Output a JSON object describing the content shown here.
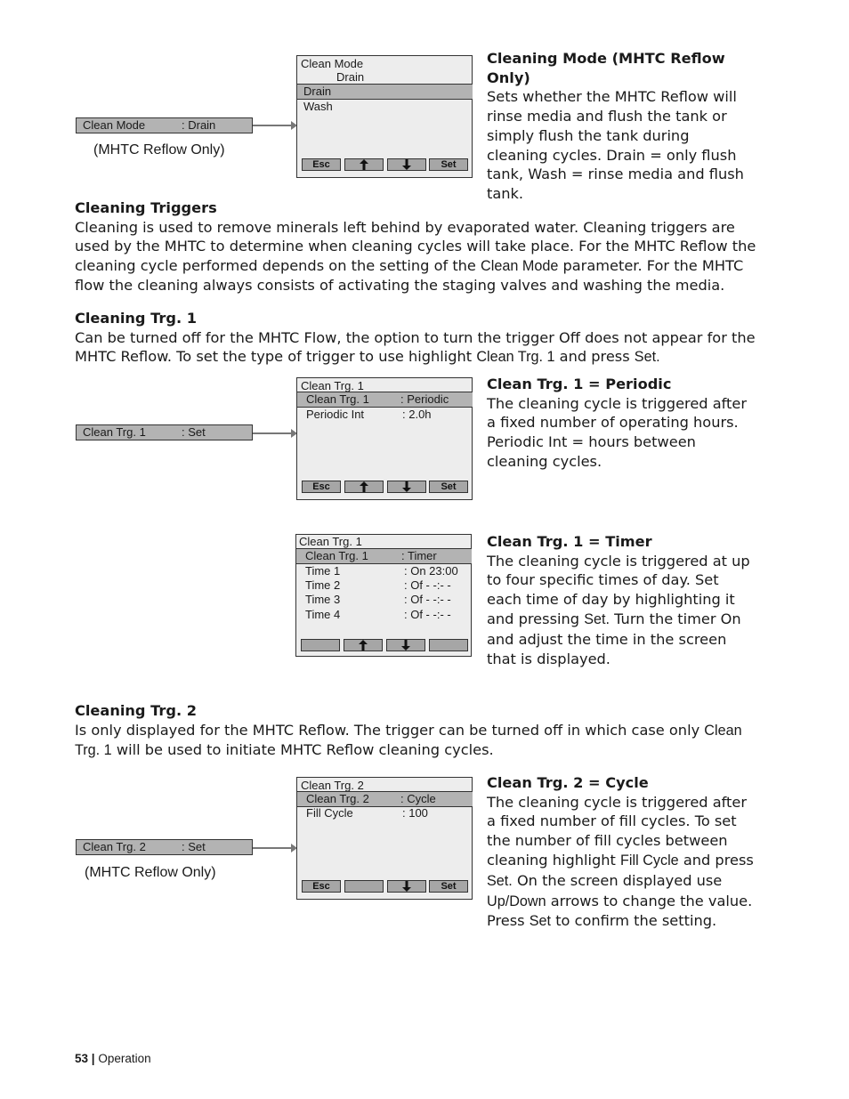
{
  "section1": {
    "param_bar": {
      "name": "Clean Mode",
      "value": ": Drain"
    },
    "note": "(MHTC Reflow Only)",
    "screen": {
      "title": "Clean Mode",
      "subtitle": "Drain",
      "options": [
        "Drain",
        "Wash"
      ],
      "buttons": {
        "left": "Esc",
        "up": "up-arrow",
        "down": "down-arrow",
        "right": "Set"
      }
    },
    "desc_title": "Cleaning Mode (MHTC Reflow Only)",
    "desc_text": "Sets whether the MHTC Reflow will rinse media and flush the tank or simply flush the tank during cleaning cycles.  Drain = only flush tank, Wash = rinse media and flush tank."
  },
  "cleaning_triggers": {
    "heading": "Cleaning Triggers",
    "text_a": "Cleaning is used to remove minerals left behind by evaporated water. Cleaning triggers are used by the MHTC to determine when cleaning cycles will take place.  For the MHTC Reflow the cleaning cycle performed depends on the setting of the ",
    "text_b": "Clean Mode",
    "text_c": " parameter.  For the MHTC flow the cleaning always consists of activating the staging valves and washing the media."
  },
  "trg1": {
    "heading": "Cleaning Trg. 1",
    "text_a": "Can be turned off for the MHTC Flow, the option to turn the trigger Off does not appear for the MHTC Reflow.  To set the type of trigger to use highlight ",
    "text_b": "Clean Trg. 1",
    "text_c": " and press ",
    "text_d": "Set.",
    "param_bar": {
      "name": "Clean Trg. 1",
      "value": ": Set"
    },
    "periodic": {
      "screen": {
        "title": "Clean Trg. 1",
        "rows": [
          {
            "name": "Clean Trg. 1",
            "value": ": Periodic"
          },
          {
            "name": "Periodic Int",
            "value": ": 2.0h"
          }
        ],
        "buttons": {
          "left": "Esc",
          "right": "Set"
        }
      },
      "desc_title": "Clean Trg. 1 = Periodic",
      "desc_text": "The cleaning cycle is triggered after a fixed number of operating hours. Periodic Int  = hours between cleaning cycles."
    },
    "timer": {
      "screen": {
        "title": "Clean Trg. 1",
        "rows": [
          {
            "name": "Clean Trg. 1",
            "value": ": Timer"
          },
          {
            "name": "Time 1",
            "value": ": On 23:00"
          },
          {
            "name": "Time 2",
            "value": ": Of  - -:- -"
          },
          {
            "name": "Time 3",
            "value": ": Of  - -:- -"
          },
          {
            "name": "Time 4",
            "value": ": Of  - -:- -"
          }
        ]
      },
      "desc_title": "Clean Trg. 1 = Timer",
      "desc_a": "The cleaning cycle is triggered at up to four specific times of day.  Set each time of day by highlighting it and pressing ",
      "desc_b": "Set.",
      "desc_c": "  Turn the timer On and adjust the time in the screen that is displayed."
    }
  },
  "trg2": {
    "heading": "Cleaning Trg. 2",
    "text_a": "Is only displayed for the MHTC Reflow.  The trigger can be turned off in which case only ",
    "text_b": "Clean Trg. 1",
    "text_c": " will be used to initiate MHTC Reflow cleaning cycles.",
    "param_bar": {
      "name": "Clean Trg. 2",
      "value": ": Set"
    },
    "note": "(MHTC Reflow Only)",
    "screen": {
      "title": "Clean Trg. 2",
      "rows": [
        {
          "name": "Clean Trg. 2",
          "value": ": Cycle"
        },
        {
          "name": "Fill Cycle",
          "value": ": 100"
        }
      ],
      "buttons": {
        "left": "Esc",
        "right": "Set"
      }
    },
    "desc_title": "Clean Trg. 2 = Cycle",
    "desc_a": "The cleaning cycle is triggered after a fixed number of fill cycles. To set the number of fill cycles between cleaning highlight ",
    "desc_b": "Fill Cycle",
    "desc_c": " and press ",
    "desc_d": "Set.",
    "desc_e": "  On the screen displayed use ",
    "desc_f": "Up/Down",
    "desc_g": " arrows to change the value. Press ",
    "desc_h": "Set",
    "desc_i": " to confirm the setting."
  },
  "footer": {
    "page": "53",
    "separator": "|",
    "section": "Operation"
  }
}
